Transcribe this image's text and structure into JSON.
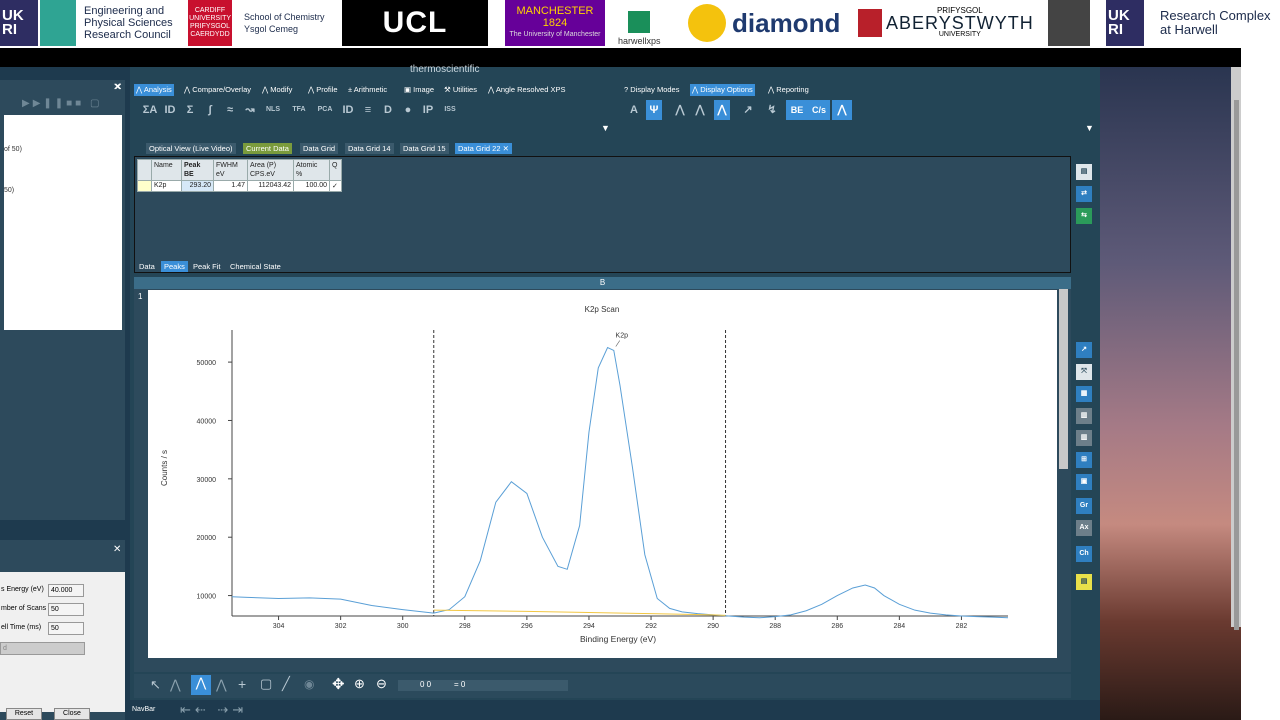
{
  "logos": {
    "ukri_left": "UK RI",
    "epsrc": [
      "Engineering and",
      "Physical Sciences",
      "Research Council"
    ],
    "cardiff": "CARDIFF UNIVERSITY PRIFYSGOL CAERDYDD",
    "chemistry": [
      "School of Chemistry",
      "Ysgol Cemeg"
    ],
    "ucl": "UCL",
    "manchester": [
      "MANCHESTER",
      "1824",
      "The University of Manchester"
    ],
    "harwellxps": "harwellxps",
    "diamond": "diamond",
    "aberystwyth": [
      "PRIFYSGOL",
      "ABERYSTWYTH",
      "UNIVERSITY"
    ],
    "ukri_right": "UK RI",
    "rch": [
      "Research Complex",
      "at Harwell"
    ]
  },
  "app": {
    "brand": "thermoscientific",
    "left_list": [
      "of 50)",
      "50)"
    ],
    "settings": [
      {
        "label": "s Energy (eV)",
        "value": "40.000"
      },
      {
        "label": "mber of Scans",
        "value": "50"
      },
      {
        "label": "ell Time  (ms)",
        "value": "50"
      }
    ],
    "disabled_field": "d",
    "reset": "Reset",
    "close": "Close",
    "toolbar_tabs": [
      "Analysis",
      "Compare/Overlay",
      "Modify",
      "Profile",
      "Arithmetic",
      "Image",
      "Utilities",
      "Angle Resolved XPS"
    ],
    "toolbar_icons": [
      "ΣA",
      "ID",
      "Σ",
      "∫",
      "≈",
      "↝",
      "NLS",
      "TFA",
      "PCA",
      "ID",
      "≡",
      "D",
      "●",
      "IP",
      "ISS"
    ],
    "display_tabs": [
      "Display Modes",
      "Display Options",
      "Reporting"
    ],
    "display_icons": [
      "A",
      "Ψ",
      "⋀",
      "⋀",
      "⋀",
      "↗",
      "↯",
      "BE",
      "C/s",
      "⋀"
    ],
    "doc_tabs": [
      "Optical View (Live Video)",
      "Current Data",
      "Data Grid",
      "Data Grid 14",
      "Data Grid 15",
      "Data Grid 22"
    ],
    "grid_headers": [
      [
        "Name",
        ""
      ],
      [
        "Peak",
        "BE"
      ],
      [
        "FWHM",
        "eV"
      ],
      [
        "Area (P)",
        "CPS.eV"
      ],
      [
        "Atomic",
        "%"
      ],
      [
        "Q",
        ""
      ]
    ],
    "grid_row": [
      "K2p",
      "293.20",
      "1.47",
      "112043.42",
      "100.00",
      "✓"
    ],
    "sub_tabs": [
      "Data",
      "Peaks",
      "Peak Fit",
      "Chemical State"
    ],
    "plot_header": "B",
    "plot_index": "1",
    "bottom_readout": [
      "0 0",
      "= 0"
    ],
    "navbar": "NavBar",
    "right_icons": [
      "▤",
      "⇄",
      "⇆",
      "↗",
      "⤧",
      "▦",
      "▥",
      "▥",
      "⊞",
      "▣",
      "Gr",
      "Ax",
      "Ch",
      "▤"
    ]
  },
  "chart_data": {
    "type": "line",
    "title": "K2p Scan",
    "xlabel": "Binding Energy (eV)",
    "ylabel": "Counts / s",
    "xlim": [
      305.5,
      280.5
    ],
    "ylim": [
      6500,
      55500
    ],
    "x_ticks": [
      304,
      302,
      300,
      298,
      296,
      294,
      292,
      290,
      288,
      286,
      284,
      282
    ],
    "y_ticks": [
      10000,
      20000,
      30000,
      40000,
      50000
    ],
    "peak_label": "K2p",
    "region_markers": [
      299.0,
      289.6
    ],
    "series": [
      {
        "x": [
          305.5,
          305,
          304,
          303,
          302,
          301,
          300,
          299,
          298.5,
          298,
          297.5,
          297,
          296.5,
          296,
          295.5,
          295,
          294.7,
          294.3,
          294,
          293.7,
          293.4,
          293.2,
          293.0,
          292.6,
          292.2,
          291.8,
          291.4,
          291,
          290.5,
          290,
          289.5,
          289,
          288.5,
          288,
          287.5,
          287,
          286.5,
          286,
          285.5,
          285.1,
          284.8,
          284.5,
          284,
          283.5,
          283,
          282.5,
          282,
          281.5,
          281,
          280.5
        ],
        "y": [
          9800,
          9700,
          9500,
          9600,
          9400,
          8300,
          7600,
          7000,
          7600,
          9800,
          16000,
          26000,
          29500,
          27500,
          20000,
          15000,
          14500,
          22000,
          38000,
          49000,
          52500,
          52000,
          46000,
          32000,
          17000,
          9500,
          7800,
          7200,
          6900,
          6700,
          6500,
          6300,
          6200,
          6400,
          6700,
          7400,
          8500,
          10000,
          11300,
          11800,
          11300,
          10000,
          8500,
          7500,
          7000,
          6700,
          6500,
          6400,
          6300,
          6200
        ]
      },
      {
        "x": [
          299,
          296,
          294,
          292,
          290,
          289.6
        ],
        "y": [
          7500,
          7300,
          7100,
          6900,
          6700,
          6600
        ]
      }
    ]
  },
  "colors": {
    "accent": "#3a8fd8",
    "spectrum": "#5a9fd6",
    "background": "#f2c744"
  }
}
